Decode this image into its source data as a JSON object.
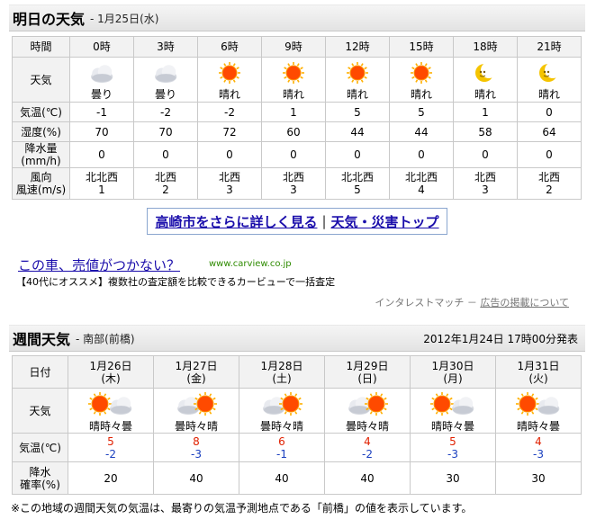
{
  "tomorrow": {
    "title": "明日の天気",
    "date": "- 1月25日(水)",
    "rows": {
      "time_label": "時間",
      "weather_label": "天気",
      "temp_label": "気温(℃)",
      "humidity_label": "湿度(%)",
      "precip_label": "降水量(mm/h)",
      "wind_dir_label": "風向",
      "wind_speed_label": "風速(m/s)"
    },
    "slots": [
      {
        "time": "0時",
        "icon": "cloudy-icon",
        "weather": "曇り",
        "temp": "-1",
        "humidity": "70",
        "precip": "0",
        "wind_dir": "北北西",
        "wind_speed": "1"
      },
      {
        "time": "3時",
        "icon": "cloudy-icon",
        "weather": "曇り",
        "temp": "-2",
        "humidity": "70",
        "precip": "0",
        "wind_dir": "北西",
        "wind_speed": "2"
      },
      {
        "time": "6時",
        "icon": "sun-icon",
        "weather": "晴れ",
        "temp": "-2",
        "humidity": "72",
        "precip": "0",
        "wind_dir": "北西",
        "wind_speed": "3"
      },
      {
        "time": "9時",
        "icon": "sun-icon",
        "weather": "晴れ",
        "temp": "1",
        "humidity": "60",
        "precip": "0",
        "wind_dir": "北西",
        "wind_speed": "3"
      },
      {
        "time": "12時",
        "icon": "sun-icon",
        "weather": "晴れ",
        "temp": "5",
        "humidity": "44",
        "precip": "0",
        "wind_dir": "北北西",
        "wind_speed": "5"
      },
      {
        "time": "15時",
        "icon": "sun-icon",
        "weather": "晴れ",
        "temp": "5",
        "humidity": "44",
        "precip": "0",
        "wind_dir": "北北西",
        "wind_speed": "4"
      },
      {
        "time": "18時",
        "icon": "moon-icon",
        "weather": "晴れ",
        "temp": "1",
        "humidity": "58",
        "precip": "0",
        "wind_dir": "北西",
        "wind_speed": "3"
      },
      {
        "time": "21時",
        "icon": "moon-icon",
        "weather": "晴れ",
        "temp": "0",
        "humidity": "64",
        "precip": "0",
        "wind_dir": "北西",
        "wind_speed": "2"
      }
    ]
  },
  "links": {
    "detail": "高崎市をさらに詳しく見る",
    "separator": "|",
    "disaster": "天気・災害トップ"
  },
  "ad": {
    "title": "この車、売値がつかない？",
    "url": "www.carview.co.jp",
    "desc": "【40代にオススメ】複数社の査定額を比較できるカービューで一括査定",
    "credit_prefix": "インタレストマッチ － ",
    "credit_link": "広告の掲載について"
  },
  "weekly": {
    "title": "週間天気",
    "region": "- 南部(前橋)",
    "issued": "2012年1月24日 17時00分発表",
    "rows": {
      "date_label": "日付",
      "weather_label": "天気",
      "temp_label": "気温(℃)",
      "precip_label_1": "降水",
      "precip_label_2": "確率(%)"
    },
    "days": [
      {
        "date": "1月26日",
        "dow": "(木)",
        "icon": "sun-cloud-icon",
        "weather": "晴時々曇",
        "high": "5",
        "low": "-2",
        "pop": "20"
      },
      {
        "date": "1月27日",
        "dow": "(金)",
        "icon": "cloud-sun-icon",
        "weather": "曇時々晴",
        "high": "8",
        "low": "-3",
        "pop": "40"
      },
      {
        "date": "1月28日",
        "dow": "(土)",
        "icon": "cloud-sun-icon",
        "weather": "曇時々晴",
        "high": "6",
        "low": "-1",
        "pop": "40"
      },
      {
        "date": "1月29日",
        "dow": "(日)",
        "icon": "cloud-sun-icon",
        "weather": "曇時々晴",
        "high": "4",
        "low": "-2",
        "pop": "40"
      },
      {
        "date": "1月30日",
        "dow": "(月)",
        "icon": "sun-cloud-icon",
        "weather": "晴時々曇",
        "high": "5",
        "low": "-3",
        "pop": "30"
      },
      {
        "date": "1月31日",
        "dow": "(火)",
        "icon": "sun-cloud-icon",
        "weather": "晴時々曇",
        "high": "4",
        "low": "-3",
        "pop": "30"
      }
    ],
    "note": "※この地域の週間天気の気温は、最寄りの気温予測地点である「前橋」の値を表示しています。"
  },
  "colors": {
    "high_temp": "#e02000",
    "low_temp": "#1a3fbf",
    "sun": "#ff4a00",
    "moon": "#f5c400",
    "link": "#1a0dab"
  }
}
